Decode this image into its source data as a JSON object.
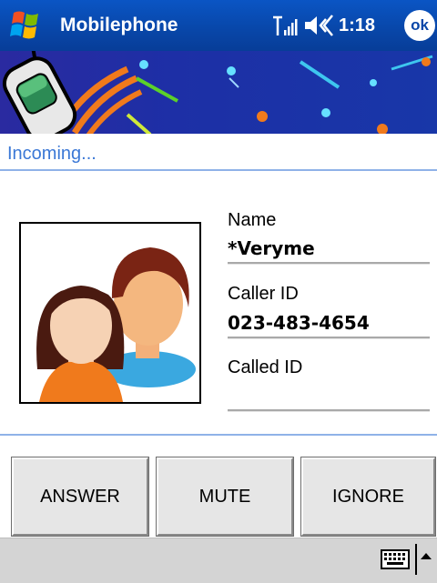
{
  "titlebar": {
    "app_title": "Mobilephone",
    "time": "1:18",
    "ok_label": "ok"
  },
  "call": {
    "status": "Incoming...",
    "name_label": "Name",
    "name_value": "*Veryme",
    "caller_id_label": "Caller ID",
    "caller_id_value": "023-483-4654",
    "called_id_label": "Called ID",
    "called_id_value": ""
  },
  "actions": {
    "answer": "ANSWER",
    "mute": "MUTE",
    "ignore": "IGNORE"
  },
  "icons": {
    "start": "windows-flag-icon",
    "signal": "signal-strength-icon",
    "volume": "speaker-icon",
    "keyboard": "keyboard-icon",
    "sip": "chevron-up-icon"
  },
  "colors": {
    "titlebar": "#0846a8",
    "status_text": "#3b78d6",
    "rule": "#8fb2e8",
    "button_face": "#e6e6e6"
  }
}
